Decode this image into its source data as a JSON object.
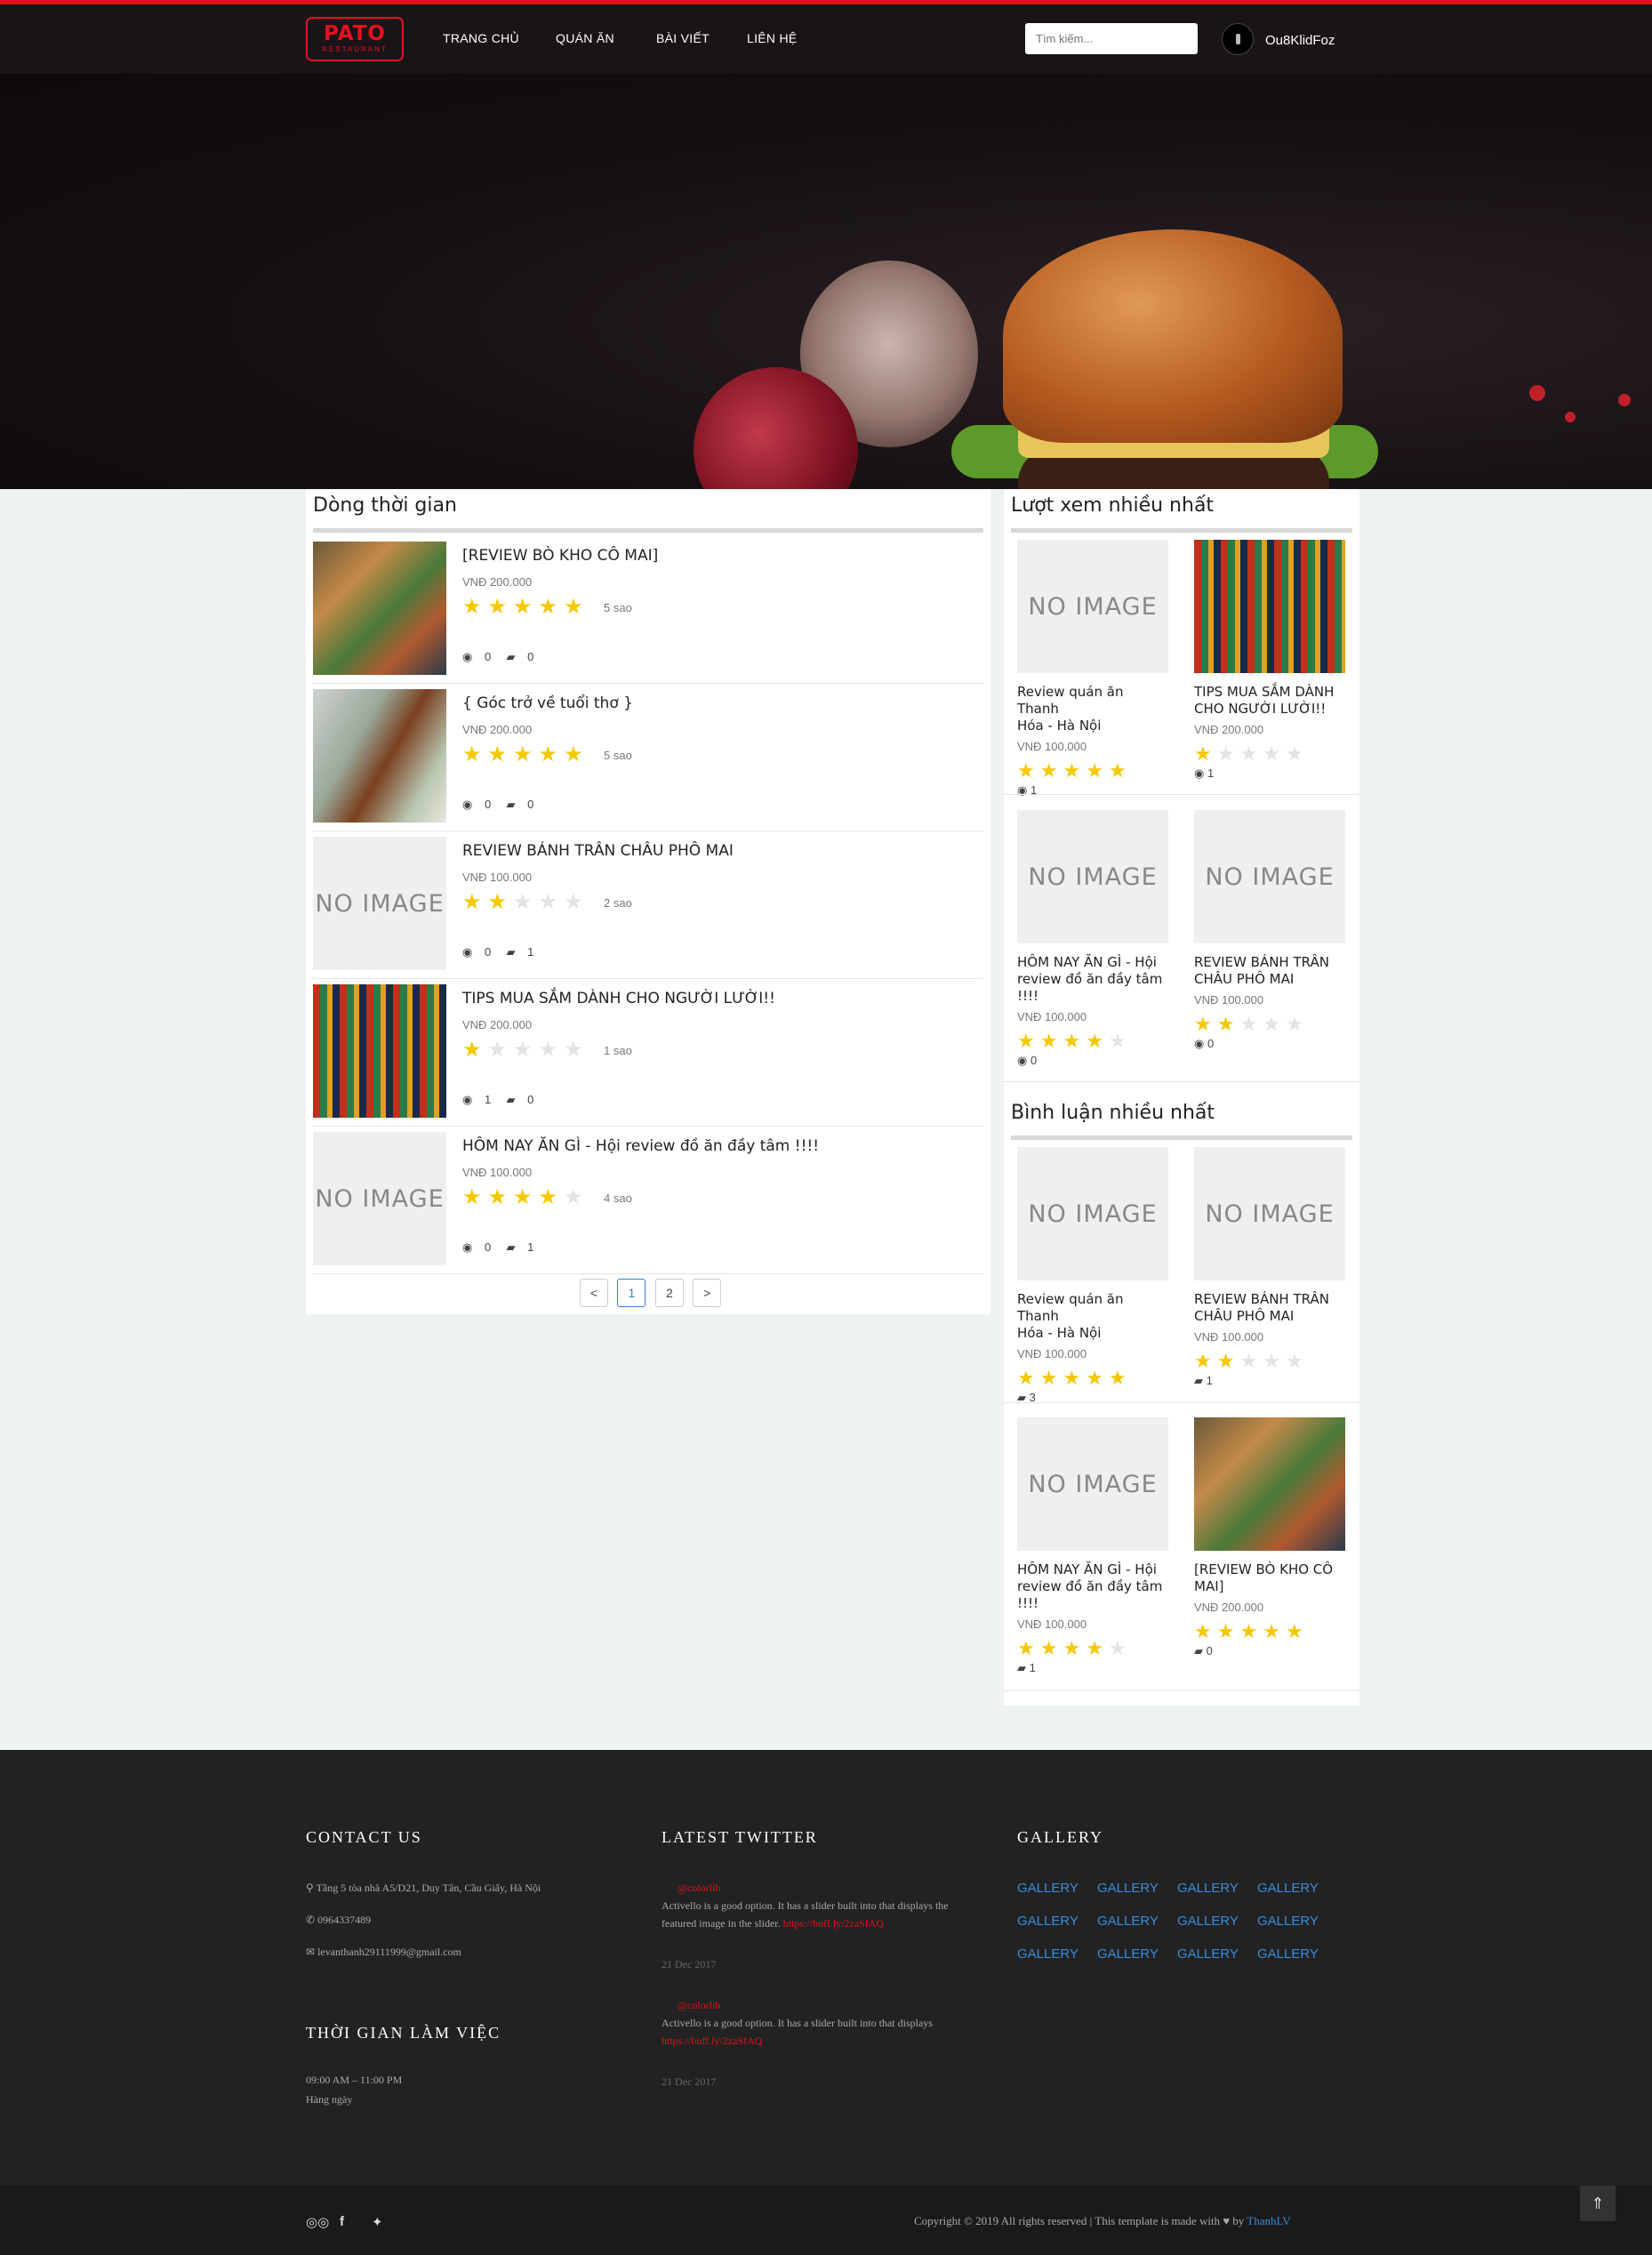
{
  "brand": {
    "name": "PATO",
    "tagline": "RESTAURANT"
  },
  "nav": [
    "TRANG CHỦ",
    "QUÁN ĂN",
    "BÀI VIẾT",
    "LIÊN HỆ"
  ],
  "search": {
    "placeholder": "Tìm kiếm..."
  },
  "user": {
    "name": "Ou8KlidFoz"
  },
  "timeline": {
    "title": "Dòng thời gian",
    "items": [
      {
        "title": "[REVIEW BÒ KHO CÔ MAI]",
        "price": "VNĐ 200.000",
        "rating": 5,
        "rating_label": "5 sao",
        "views": "0",
        "comments": "0",
        "image": "food-photo"
      },
      {
        "title": "{ Góc trở về tuổi thơ }",
        "price": "VNĐ 200.000",
        "rating": 5,
        "rating_label": "5 sao",
        "views": "0",
        "comments": "0",
        "image": "food-photo"
      },
      {
        "title": "REVIEW BÁNH TRÂN CHÂU PHÔ MAI",
        "price": "VNĐ 100.000",
        "rating": 2,
        "rating_label": "2 sao",
        "views": "0",
        "comments": "1",
        "image": "NO IMAGE"
      },
      {
        "title": "TIPS MUA SẮM DÀNH CHO NGƯỜI LƯỜI!!",
        "price": "VNĐ 200.000",
        "rating": 1,
        "rating_label": "1 sao",
        "views": "1",
        "comments": "0",
        "image": "market-photo"
      },
      {
        "title": "HÔM NAY ĂN GÌ - Hội review đồ ăn đầy tâm !!!!",
        "price": "VNĐ 100.000",
        "rating": 4,
        "rating_label": "4 sao",
        "views": "0",
        "comments": "1",
        "image": "NO IMAGE"
      }
    ],
    "pagination": [
      "<",
      "1",
      "2",
      ">"
    ]
  },
  "most_viewed": {
    "title": "Lượt xem nhiều nhất",
    "items": [
      {
        "title_l1": "Review quán ăn Thanh",
        "title_l2": "Hóa - Hà Nội",
        "title_l3": "",
        "price": "VNĐ 100.000",
        "rating": 5,
        "count": "1"
      },
      {
        "title_l1": "TIPS MUA SẮM DÀNH",
        "title_l2": "CHO NGƯỜI LƯỜI!!",
        "title_l3": "",
        "price": "VNĐ 200.000",
        "rating": 1,
        "count": "1"
      },
      {
        "title_l1": "HÔM NAY ĂN GÌ - Hội",
        "title_l2": "review đồ ăn đầy tâm",
        "title_l3": "!!!!",
        "price": "VNĐ 100.000",
        "rating": 4,
        "count": "0"
      },
      {
        "title_l1": "REVIEW BÁNH TRÂN",
        "title_l2": "CHÂU PHÔ MAI",
        "title_l3": "",
        "price": "VNĐ 100.000",
        "rating": 2,
        "count": "0"
      }
    ]
  },
  "most_commented": {
    "title": "Bình luận nhiều nhất",
    "items": [
      {
        "title_l1": "Review quán ăn Thanh",
        "title_l2": "Hóa - Hà Nội",
        "title_l3": "",
        "price": "VNĐ 100.000",
        "rating": 5,
        "count": "3"
      },
      {
        "title_l1": "REVIEW BÁNH TRÂN",
        "title_l2": "CHÂU PHÔ MAI",
        "title_l3": "",
        "price": "VNĐ 100.000",
        "rating": 2,
        "count": "1"
      },
      {
        "title_l1": "HÔM NAY ĂN GÌ - Hội",
        "title_l2": "review đồ ăn đầy tâm",
        "title_l3": "!!!!",
        "price": "VNĐ 100.000",
        "rating": 4,
        "count": "1"
      },
      {
        "title_l1": "[REVIEW BÒ KHO CÔ",
        "title_l2": "MAI]",
        "title_l3": "",
        "price": "VNĐ 200.000",
        "rating": 5,
        "count": "0"
      }
    ]
  },
  "no_image": "NO IMAGE",
  "footer": {
    "contact_title": "CONTACT US",
    "address": "Tầng 5 tòa nhà A5/D21, Duy Tân, Cầu Giấy, Hà Nội",
    "phone": "0964337489",
    "email": "levanthanh29111999@gmail.com",
    "hours_title": "THỜI GIAN LÀM VIỆC",
    "hours": "09:00 AM – 11:00 PM",
    "days": "Hàng ngày",
    "twitter_title": "LATEST TWITTER",
    "tweets": [
      {
        "handle": "@colorlib",
        "text_l1": "Activello is a good option. It has a slider built into that displays the",
        "text_l2": "featured image in the slider. ",
        "link": "https://buff.ly/2zaSfAQ",
        "date": "21 Dec 2017"
      },
      {
        "handle": "@colorlib",
        "text_l1": "Activello is a good option. It has a slider built into that displays",
        "text_l2": "",
        "link": "https://buff.ly/2zaSfAQ",
        "date": "21 Dec 2017"
      }
    ],
    "gallery_title": "GALLERY",
    "gallery_label": "GALLERY",
    "copyright": "Copyright © 2019 All rights reserved | This template is made with",
    "by": "by",
    "author": "ThanhLV"
  },
  "colors": {
    "accent": "#e0121d",
    "star_on": "#f5c800",
    "star_off": "#e3e3e3",
    "link": "#3a8ddb"
  }
}
